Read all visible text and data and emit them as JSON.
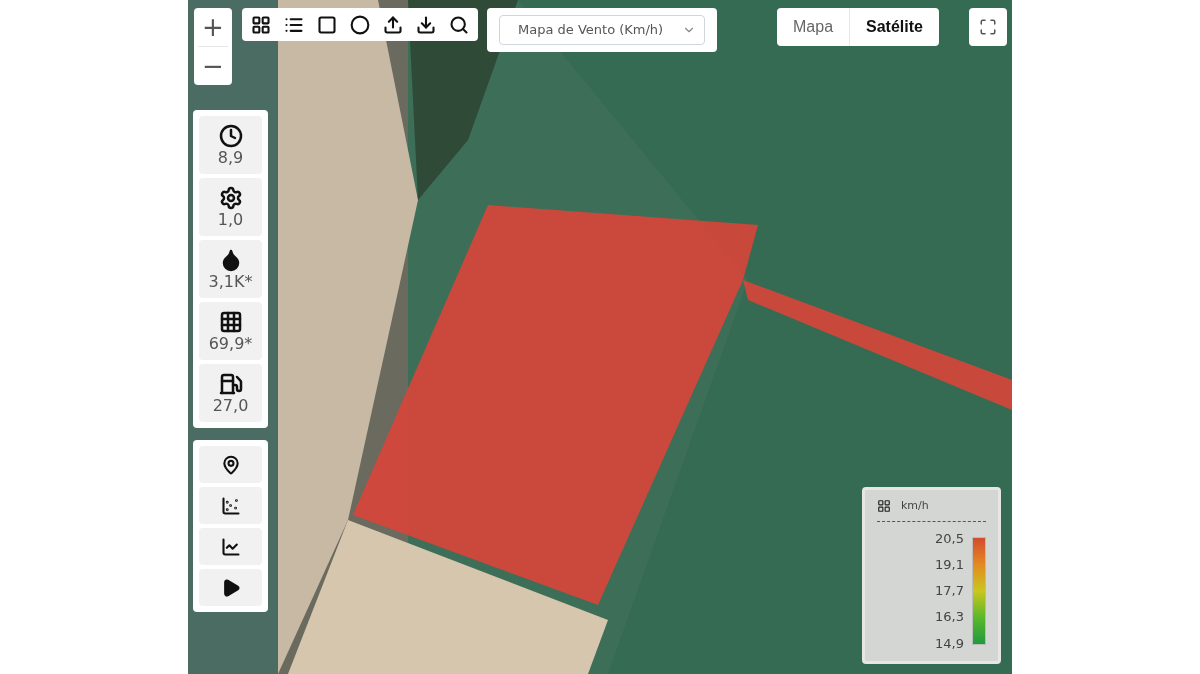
{
  "zoom": {
    "in": "+",
    "out": "−"
  },
  "toolbar": {
    "tools": [
      {
        "kind": "grid"
      },
      {
        "kind": "list"
      },
      {
        "kind": "square"
      },
      {
        "kind": "circle"
      },
      {
        "kind": "upload"
      },
      {
        "kind": "download"
      },
      {
        "kind": "search"
      }
    ]
  },
  "layer_select": {
    "value": "Mapa de Vento (Km/h)"
  },
  "map_type_tabs": [
    {
      "label": "Mapa",
      "selected": false
    },
    {
      "label": "Satélite",
      "selected": true
    }
  ],
  "stats": [
    {
      "kind": "clock",
      "value": "8,9"
    },
    {
      "kind": "gear-clock",
      "value": "1,0"
    },
    {
      "kind": "drop",
      "value": "3,1K*"
    },
    {
      "kind": "grid",
      "value": "69,9*"
    },
    {
      "kind": "fuel",
      "value": "27,0"
    }
  ],
  "tools": [
    {
      "kind": "location"
    },
    {
      "kind": "grid-chart"
    },
    {
      "kind": "line-chart"
    },
    {
      "kind": "play"
    }
  ],
  "legend": {
    "unit": "km/h",
    "ticks": [
      "20,5",
      "19,1",
      "17,7",
      "16,3",
      "14,9"
    ]
  }
}
